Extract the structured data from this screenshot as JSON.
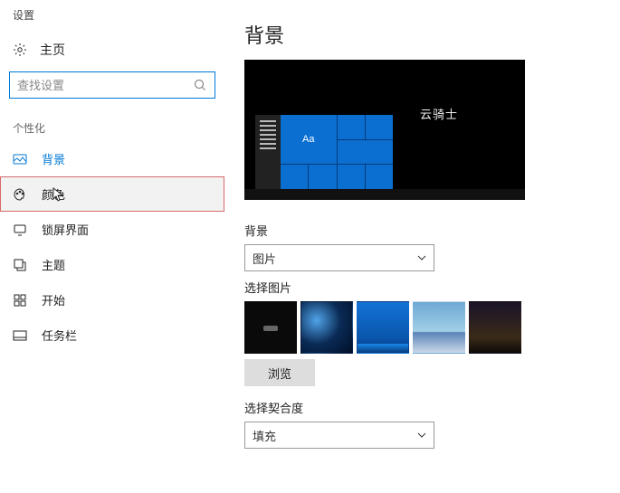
{
  "window_title": "设置",
  "home_label": "主页",
  "search": {
    "placeholder": "查找设置"
  },
  "category_label": "个性化",
  "nav": [
    {
      "icon": "image-icon",
      "label": "背景",
      "active": true
    },
    {
      "icon": "palette-icon",
      "label": "颜色",
      "hovered": true
    },
    {
      "icon": "lock-icon",
      "label": "锁屏界面"
    },
    {
      "icon": "theme-icon",
      "label": "主题"
    },
    {
      "icon": "start-icon",
      "label": "开始"
    },
    {
      "icon": "taskbar-icon",
      "label": "任务栏"
    }
  ],
  "main": {
    "title": "背景",
    "preview_brand": "云骑士",
    "preview_tile_text": "Aa",
    "bg_label": "背景",
    "bg_select_value": "图片",
    "pick_label": "选择图片",
    "browse_label": "浏览",
    "fit_label": "选择契合度",
    "fit_select_value": "填充"
  },
  "colors": {
    "accent": "#0078d7"
  }
}
